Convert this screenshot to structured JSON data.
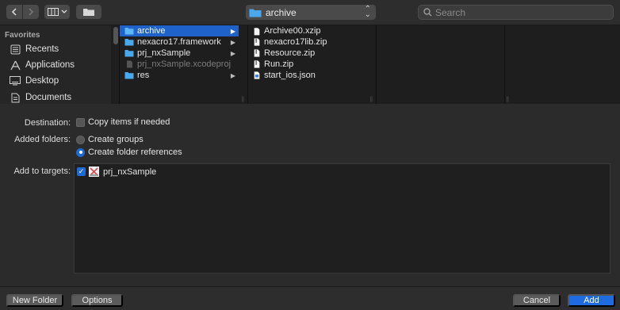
{
  "toolbar": {
    "path_label": "archive",
    "search_placeholder": "Search"
  },
  "sidebar": {
    "heading": "Favorites",
    "items": [
      {
        "label": "Recents",
        "icon": "recents-icon"
      },
      {
        "label": "Applications",
        "icon": "applications-icon"
      },
      {
        "label": "Desktop",
        "icon": "desktop-icon"
      },
      {
        "label": "Documents",
        "icon": "documents-icon"
      }
    ]
  },
  "column1": {
    "items": [
      {
        "label": "archive",
        "type": "folder",
        "selected": true
      },
      {
        "label": "nexacro17.framework",
        "type": "folder"
      },
      {
        "label": "prj_nxSample",
        "type": "folder"
      },
      {
        "label": "prj_nxSample.xcodeproj",
        "type": "file",
        "dimmed": true
      },
      {
        "label": "res",
        "type": "folder"
      }
    ]
  },
  "column2": {
    "items": [
      {
        "label": "Archive00.xzip",
        "type": "file"
      },
      {
        "label": "nexacro17lib.zip",
        "type": "file"
      },
      {
        "label": "Resource.zip",
        "type": "file"
      },
      {
        "label": "Run.zip",
        "type": "file"
      },
      {
        "label": "start_ios.json",
        "type": "json"
      }
    ]
  },
  "form": {
    "destination_label": "Destination:",
    "copy_items_label": "Copy items if needed",
    "copy_items_checked": false,
    "added_folders_label": "Added folders:",
    "create_groups_label": "Create groups",
    "create_folder_refs_label": "Create folder references",
    "selected_folder_option": "Create folder references",
    "add_targets_label": "Add to targets:",
    "targets": [
      {
        "label": "prj_nxSample",
        "checked": true
      }
    ]
  },
  "buttons": {
    "new_folder": "New Folder",
    "options": "Options",
    "cancel": "Cancel",
    "add": "Add"
  },
  "colors": {
    "accent": "#1f62c9",
    "folder": "#4aa8ee",
    "primary_button": "#1f6ce0"
  }
}
